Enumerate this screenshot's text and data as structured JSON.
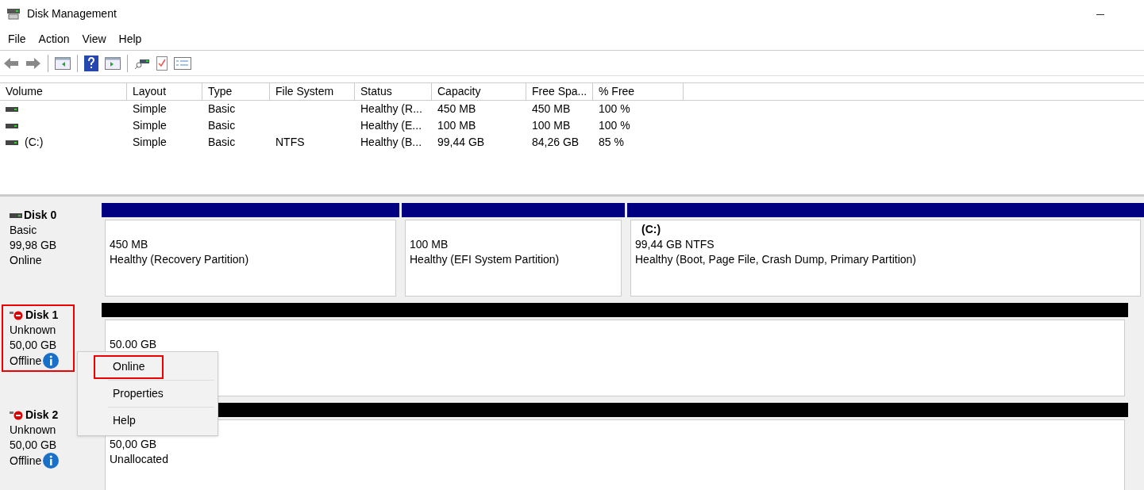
{
  "window": {
    "title": "Disk Management"
  },
  "menu": [
    "File",
    "Action",
    "View",
    "Help"
  ],
  "table": {
    "columns": [
      "Volume",
      "Layout",
      "Type",
      "File System",
      "Status",
      "Capacity",
      "Free Spa...",
      "% Free"
    ],
    "rows": [
      [
        "",
        "Simple",
        "Basic",
        "",
        "Healthy (R...",
        "450 MB",
        "450 MB",
        "100 %"
      ],
      [
        "",
        "Simple",
        "Basic",
        "",
        "Healthy (E...",
        "100 MB",
        "100 MB",
        "100 %"
      ],
      [
        "(C:)",
        "Simple",
        "Basic",
        "NTFS",
        "Healthy (B...",
        "99,44 GB",
        "84,26 GB",
        "85 %"
      ]
    ]
  },
  "disks": [
    {
      "name": "Disk 0",
      "type": "Basic",
      "size": "99,98 GB",
      "status": "Online",
      "offline": false,
      "highlighted": false,
      "kind": "allocated",
      "partitions": [
        {
          "size": "450 MB",
          "status": "Healthy (Recovery Partition)"
        },
        {
          "size": "100 MB",
          "status": "Healthy (EFI System Partition)"
        },
        {
          "label": "(C:)",
          "size": "99,44 GB NTFS",
          "status": "Healthy (Boot, Page File, Crash Dump, Primary Partition)"
        }
      ]
    },
    {
      "name": "Disk 1",
      "type": "Unknown",
      "size": "50,00 GB",
      "status": "Offline",
      "offline": true,
      "highlighted": true,
      "kind": "unallocated",
      "partitions": [
        {
          "size": "50.00 GB"
        }
      ]
    },
    {
      "name": "Disk 2",
      "type": "Unknown",
      "size": "50,00 GB",
      "status": "Offline",
      "offline": true,
      "highlighted": false,
      "kind": "unallocated",
      "partitions": [
        {
          "size": "50,00 GB",
          "status": "Unallocated"
        }
      ]
    }
  ],
  "context_menu": [
    {
      "label": "Online",
      "highlighted": true
    },
    {
      "label": "Properties",
      "highlighted": false
    },
    {
      "label": "Help",
      "highlighted": false
    }
  ]
}
